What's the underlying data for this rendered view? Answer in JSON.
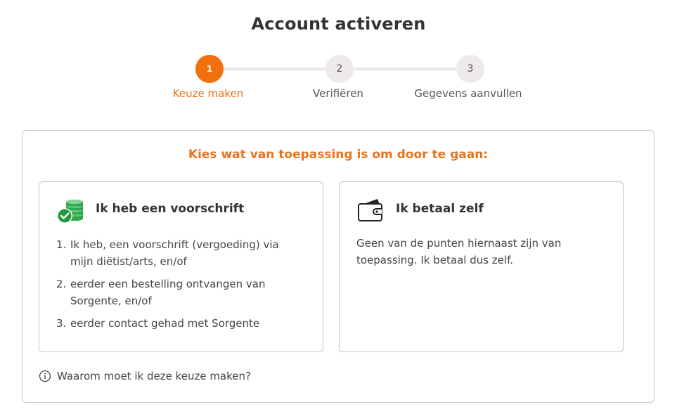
{
  "page": {
    "title": "Account activeren"
  },
  "stepper": {
    "steps": [
      {
        "number": "1",
        "label": "Keuze maken",
        "active": true
      },
      {
        "number": "2",
        "label": "Verifiëren",
        "active": false
      },
      {
        "number": "3",
        "label": "Gegevens aanvullen",
        "active": false
      }
    ]
  },
  "card": {
    "heading": "Kies wat van toepassing is om door te gaan:",
    "options": [
      {
        "icon": "coins-check-icon",
        "title": "Ik heb een voorschrift",
        "items": [
          {
            "num": "1.",
            "text": "Ik heb, een voorschrift (vergoeding) via mijn diëtist/arts, en/of"
          },
          {
            "num": "2.",
            "text": "eerder een bestelling ontvangen van Sorgente, en/of"
          },
          {
            "num": "3.",
            "text": "eerder contact gehad met Sorgente"
          }
        ]
      },
      {
        "icon": "wallet-icon",
        "title": "Ik betaal zelf",
        "text": "Geen van de punten hiernaast zijn van toepassing. Ik betaal dus zelf."
      }
    ],
    "why_link": "Waarom moet ik deze keuze maken?"
  },
  "colors": {
    "accent": "#f26f0e",
    "accent_text": "#e8731c",
    "success": "#2aa84a",
    "border": "#c9c9c9"
  }
}
